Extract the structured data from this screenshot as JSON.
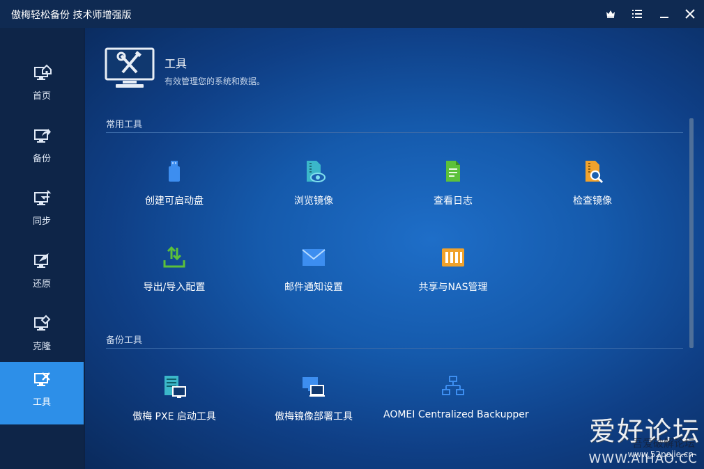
{
  "window": {
    "title": "傲梅轻松备份 技术师增强版"
  },
  "colors": {
    "accent": "#2d8fe8",
    "sidebar": "#0e2548",
    "titlebar": "#0f2a52"
  },
  "titlebar_buttons": [
    {
      "icon": "crown-icon"
    },
    {
      "icon": "menu-icon"
    },
    {
      "icon": "minimize-icon"
    },
    {
      "icon": "close-icon"
    }
  ],
  "sidebar": {
    "items": [
      {
        "label": "首页",
        "icon": "home-monitor-icon",
        "active": false
      },
      {
        "label": "备份",
        "icon": "backup-monitor-icon",
        "active": false
      },
      {
        "label": "同步",
        "icon": "sync-monitor-icon",
        "active": false
      },
      {
        "label": "还原",
        "icon": "restore-monitor-icon",
        "active": false
      },
      {
        "label": "克隆",
        "icon": "clone-monitor-icon",
        "active": false
      },
      {
        "label": "工具",
        "icon": "tools-monitor-icon",
        "active": true
      }
    ]
  },
  "page": {
    "title": "工具",
    "subtitle": "有效管理您的系统和数据。"
  },
  "sections": {
    "common": {
      "title": "常用工具",
      "tools": [
        {
          "label": "创建可启动盘",
          "icon": "usb-drive-icon"
        },
        {
          "label": "浏览镜像",
          "icon": "explore-image-icon"
        },
        {
          "label": "查看日志",
          "icon": "log-document-icon"
        },
        {
          "label": "检查镜像",
          "icon": "check-image-icon"
        },
        {
          "label": "导出/导入配置",
          "icon": "export-import-icon"
        },
        {
          "label": "邮件通知设置",
          "icon": "mail-icon"
        },
        {
          "label": "共享与NAS管理",
          "icon": "nas-icon"
        }
      ]
    },
    "backup": {
      "title": "备份工具",
      "tools": [
        {
          "label": "傲梅 PXE 启动工具",
          "icon": "pxe-server-icon"
        },
        {
          "label": "傲梅镜像部署工具",
          "icon": "image-deploy-icon"
        },
        {
          "label": "AOMEI Centralized Backupper",
          "icon": "network-topology-icon"
        }
      ]
    }
  },
  "watermark": {
    "line1": "爱好论坛",
    "line2": "吾爱破解论坛",
    "line3": "www.52pojie.cn",
    "line4": "WWW.AIHAO.CC"
  }
}
